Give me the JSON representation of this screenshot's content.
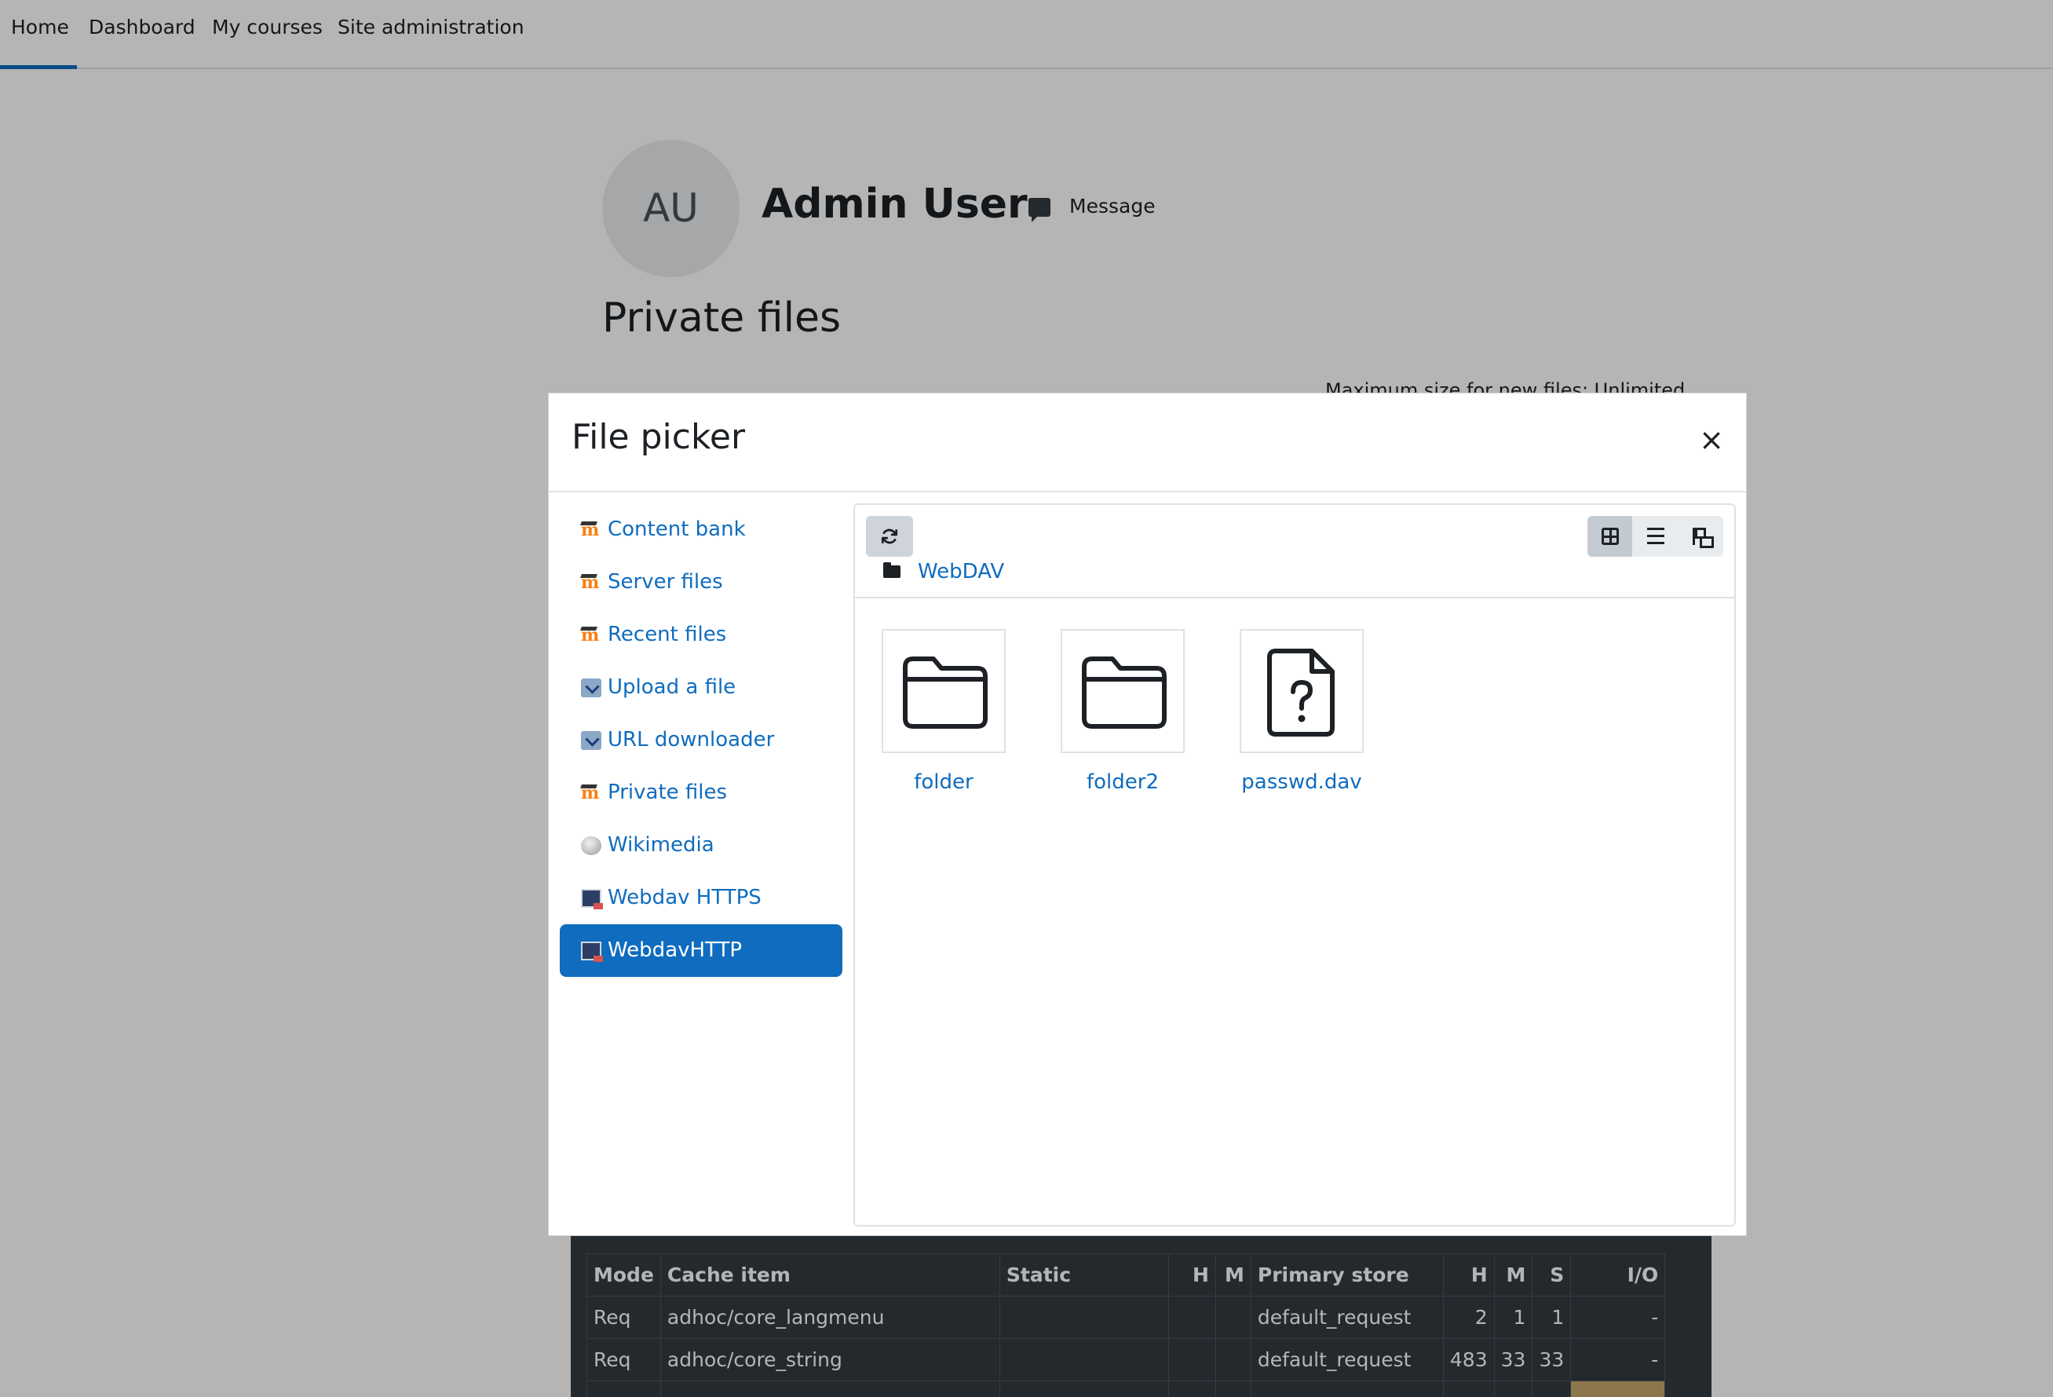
{
  "nav": {
    "items": [
      {
        "label": "Home",
        "active": true
      },
      {
        "label": "Dashboard",
        "active": false
      },
      {
        "label": "My courses",
        "active": false
      },
      {
        "label": "Site administration",
        "active": false
      }
    ]
  },
  "profile": {
    "initials": "AU",
    "name": "Admin User",
    "message_label": "Message"
  },
  "page": {
    "title": "Private files",
    "max_size_text": "Maximum size for new files: Unlimited"
  },
  "file_picker": {
    "title": "File picker",
    "close_label": "×",
    "repositories": [
      {
        "label": "Content bank",
        "icon": "moodle-icon",
        "active": false
      },
      {
        "label": "Server files",
        "icon": "moodle-icon",
        "active": false
      },
      {
        "label": "Recent files",
        "icon": "moodle-icon",
        "active": false
      },
      {
        "label": "Upload a file",
        "icon": "upload-icon",
        "active": false
      },
      {
        "label": "URL downloader",
        "icon": "upload-icon",
        "active": false
      },
      {
        "label": "Private files",
        "icon": "moodle-icon",
        "active": false
      },
      {
        "label": "Wikimedia",
        "icon": "wikimedia-icon",
        "active": false
      },
      {
        "label": "Webdav HTTPS",
        "icon": "webdav-icon",
        "active": false
      },
      {
        "label": "WebdavHTTP",
        "icon": "webdav-icon",
        "active": true
      }
    ],
    "refresh_icon": "refresh-icon",
    "view_modes": [
      {
        "name": "icons",
        "icon": "grid-icon",
        "active": true
      },
      {
        "name": "list",
        "icon": "list-icon",
        "active": false
      },
      {
        "name": "tree",
        "icon": "tree-icon",
        "active": false
      }
    ],
    "breadcrumb": "WebDAV",
    "files": [
      {
        "name": "folder",
        "type": "folder"
      },
      {
        "name": "folder2",
        "type": "folder"
      },
      {
        "name": "passwd.dav",
        "type": "unknown-file"
      }
    ]
  },
  "perf_table": {
    "headers": [
      "Mode",
      "Cache item",
      "Static",
      "H",
      "M",
      "Primary store",
      "H",
      "M",
      "S",
      "I/O"
    ],
    "rows": [
      [
        "Req",
        "adhoc/core_langmenu",
        "",
        "",
        "",
        "default_request",
        "2",
        "1",
        "1",
        "-"
      ],
      [
        "Req",
        "adhoc/core_string",
        "",
        "",
        "",
        "default_request",
        "483",
        "33",
        "33",
        "-"
      ]
    ],
    "colors": {
      "background": "#343a40",
      "highlight": "#c9a66b"
    }
  },
  "colors": {
    "accent": "#0f6cbf",
    "backdrop": "rgba(0,0,0,0.29)"
  }
}
